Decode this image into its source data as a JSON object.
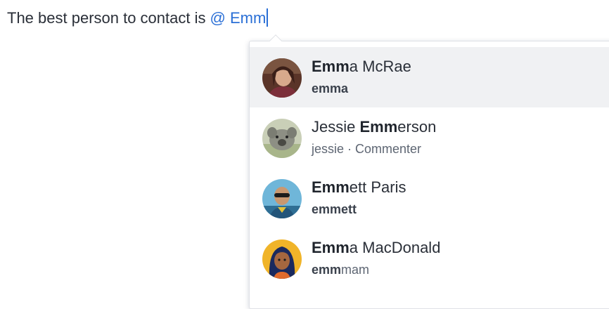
{
  "editor": {
    "text": "The best person to contact is",
    "mention_query": "@ Emm"
  },
  "mention_popup": {
    "options": [
      {
        "name_match": "Emm",
        "name_rest": "a McRae",
        "username_match": "emm",
        "username_rest": "a",
        "role": "",
        "selected": true,
        "avatar": "emma-mcrae-photo"
      },
      {
        "name_prefix": "Jessie ",
        "name_match": "Emm",
        "name_rest": "erson",
        "username": "jessie",
        "role": " · Commenter",
        "selected": false,
        "avatar": "jessie-emmerson-photo"
      },
      {
        "name_match": "Emm",
        "name_rest": "ett Paris",
        "username_match": "emm",
        "username_rest": "ett",
        "role": "",
        "selected": false,
        "avatar": "emmett-paris-photo"
      },
      {
        "name_match": "Emm",
        "name_rest": "a MacDonald",
        "username_match": "emm",
        "username_rest": "mam",
        "role": "",
        "selected": false,
        "avatar": "emma-macdonald-illustration"
      }
    ]
  },
  "colors": {
    "mention": "#2a6fd6",
    "text": "#2a2f38",
    "secondary": "#5e6673",
    "selected_bg": "#f0f1f3"
  }
}
